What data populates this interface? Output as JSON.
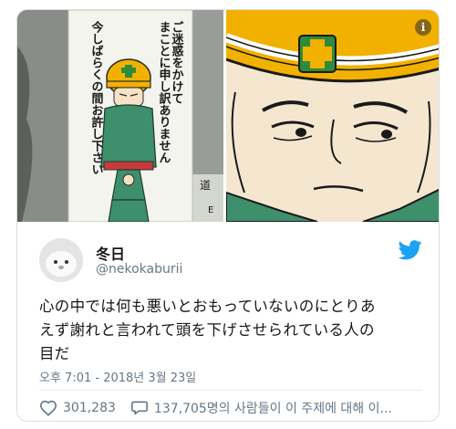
{
  "left_image": {
    "sign_text": "ご迷惑をかけて まことに申し訳ありません 今しばらくの間お許し下さい",
    "sign_columns": [
      "ご迷惑をかけて",
      "まことに申し訳ありません",
      "今しばらくの間お許し下さい"
    ],
    "sign_corner_text": "道",
    "sign_edge_text": "E"
  },
  "tweet": {
    "display_name": "冬日",
    "handle": "@nekokaburii",
    "text_line1": "心の中では何も悪いとおもっていないのにとりあ",
    "text_line2": "えず謝れと言われて頭を下げさせられている人の",
    "text_line3": "目だ",
    "timestamp": "오후 7:01 - 2018년 3월 23일",
    "likes": "301,283",
    "replies_summary": "137,705명의 사람들이 이 주제에 대해 이..."
  },
  "colors": {
    "twitter_blue": "#1da1f2",
    "helmet_yellow": "#f2b100",
    "uniform_green": "#3e8f6c",
    "cross_green": "#2e8b3a",
    "text_gray": "#657786"
  },
  "icons": [
    "info-icon",
    "twitter-bird-icon",
    "heart-icon",
    "speech-bubble-icon"
  ]
}
